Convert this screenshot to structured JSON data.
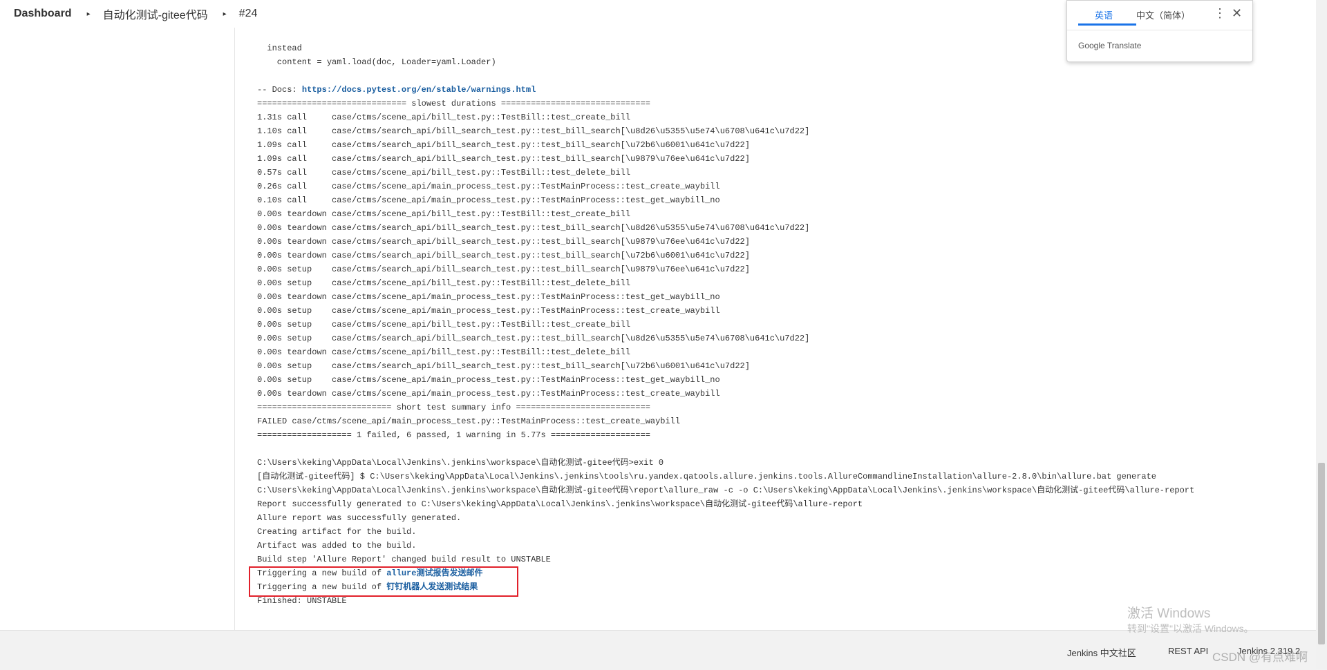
{
  "breadcrumb": {
    "items": [
      "Dashboard",
      "自动化测试-gitee代码",
      "#24"
    ],
    "separator": "▸"
  },
  "console": {
    "lines": [
      "  instead",
      "    content = yaml.load(doc, Loader=yaml.Loader)",
      "",
      "-- Docs: https://docs.pytest.org/en/stable/warnings.html",
      "============================== slowest durations ==============================",
      "1.31s call     case/ctms/scene_api/bill_test.py::TestBill::test_create_bill",
      "1.10s call     case/ctms/search_api/bill_search_test.py::test_bill_search[\\u8d26\\u5355\\u5e74\\u6708\\u641c\\u7d22]",
      "1.09s call     case/ctms/search_api/bill_search_test.py::test_bill_search[\\u72b6\\u6001\\u641c\\u7d22]",
      "1.09s call     case/ctms/search_api/bill_search_test.py::test_bill_search[\\u9879\\u76ee\\u641c\\u7d22]",
      "0.57s call     case/ctms/scene_api/bill_test.py::TestBill::test_delete_bill",
      "0.26s call     case/ctms/scene_api/main_process_test.py::TestMainProcess::test_create_waybill",
      "0.10s call     case/ctms/scene_api/main_process_test.py::TestMainProcess::test_get_waybill_no",
      "0.00s teardown case/ctms/scene_api/bill_test.py::TestBill::test_create_bill",
      "0.00s teardown case/ctms/search_api/bill_search_test.py::test_bill_search[\\u8d26\\u5355\\u5e74\\u6708\\u641c\\u7d22]",
      "0.00s teardown case/ctms/search_api/bill_search_test.py::test_bill_search[\\u9879\\u76ee\\u641c\\u7d22]",
      "0.00s teardown case/ctms/search_api/bill_search_test.py::test_bill_search[\\u72b6\\u6001\\u641c\\u7d22]",
      "0.00s setup    case/ctms/search_api/bill_search_test.py::test_bill_search[\\u9879\\u76ee\\u641c\\u7d22]",
      "0.00s setup    case/ctms/scene_api/bill_test.py::TestBill::test_delete_bill",
      "0.00s teardown case/ctms/scene_api/main_process_test.py::TestMainProcess::test_get_waybill_no",
      "0.00s setup    case/ctms/scene_api/main_process_test.py::TestMainProcess::test_create_waybill",
      "0.00s setup    case/ctms/scene_api/bill_test.py::TestBill::test_create_bill",
      "0.00s setup    case/ctms/search_api/bill_search_test.py::test_bill_search[\\u8d26\\u5355\\u5e74\\u6708\\u641c\\u7d22]",
      "0.00s teardown case/ctms/scene_api/bill_test.py::TestBill::test_delete_bill",
      "0.00s setup    case/ctms/search_api/bill_search_test.py::test_bill_search[\\u72b6\\u6001\\u641c\\u7d22]",
      "0.00s setup    case/ctms/scene_api/main_process_test.py::TestMainProcess::test_get_waybill_no",
      "0.00s teardown case/ctms/scene_api/main_process_test.py::TestMainProcess::test_create_waybill",
      "=========================== short test summary info ===========================",
      "FAILED case/ctms/scene_api/main_process_test.py::TestMainProcess::test_create_waybill",
      "=================== 1 failed, 6 passed, 1 warning in 5.77s ====================",
      "",
      "C:\\Users\\keking\\AppData\\Local\\Jenkins\\.jenkins\\workspace\\自动化测试-gitee代码>exit 0",
      "[自动化测试-gitee代码] $ C:\\Users\\keking\\AppData\\Local\\Jenkins\\.jenkins\\tools\\ru.yandex.qatools.allure.jenkins.tools.AllureCommandlineInstallation\\allure-2.8.0\\bin\\allure.bat generate",
      "C:\\Users\\keking\\AppData\\Local\\Jenkins\\.jenkins\\workspace\\自动化测试-gitee代码\\report\\allure_raw -c -o C:\\Users\\keking\\AppData\\Local\\Jenkins\\.jenkins\\workspace\\自动化测试-gitee代码\\allure-report",
      "Report successfully generated to C:\\Users\\keking\\AppData\\Local\\Jenkins\\.jenkins\\workspace\\自动化测试-gitee代码\\allure-report",
      "Allure report was successfully generated.",
      "Creating artifact for the build.",
      "Artifact was added to the build.",
      "Build step 'Allure Report' changed build result to UNSTABLE"
    ],
    "docs_prefix": "-- Docs: ",
    "docs_link": "https://docs.pytest.org/en/stable/warnings.html",
    "trigger_prefix": "Triggering a new build of ",
    "trigger_link_1": "allure测试报告发送邮件",
    "trigger_link_2": "钉钉机器人发送测试结果",
    "finished": "Finished: UNSTABLE"
  },
  "translate": {
    "tab_english": "英语",
    "tab_chinese": "中文（简体）",
    "menu_icon": "⋮",
    "close_icon": "✕",
    "brand": "Google Translate"
  },
  "footer": {
    "community": "Jenkins 中文社区",
    "rest_api": "REST API",
    "version": "Jenkins 2.319.2"
  },
  "watermark": {
    "line1": "激活 Windows",
    "line2": "转到\"设置\"以激活 Windows。",
    "csdn": "CSDN @有点难啊"
  },
  "colors": {
    "link": "#1a5ea0",
    "highlight_border": "#e1202a",
    "translate_accent": "#1a73e8"
  }
}
